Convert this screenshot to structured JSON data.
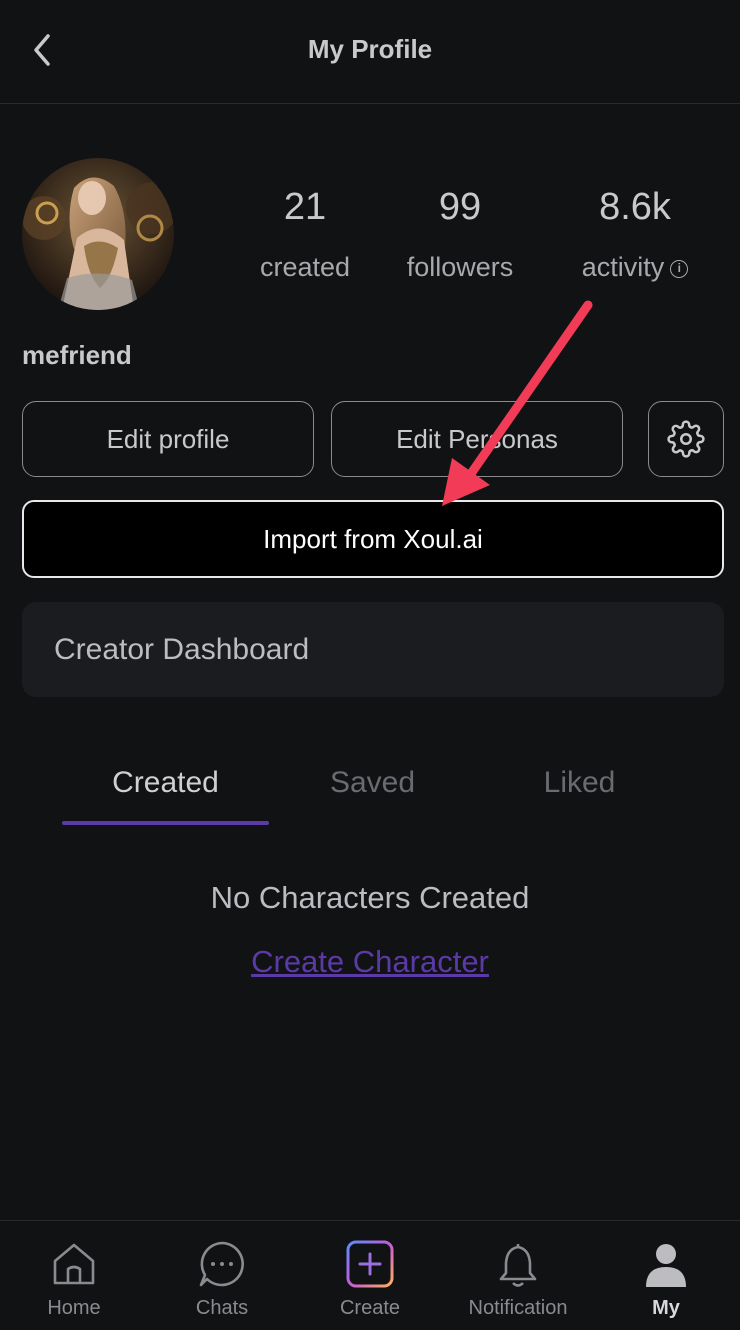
{
  "header": {
    "title": "My Profile",
    "back_icon": "chevron-left-icon"
  },
  "profile": {
    "username": "mefriend",
    "stats": [
      {
        "value": "21",
        "label": "created"
      },
      {
        "value": "99",
        "label": "followers"
      },
      {
        "value": "8.6k",
        "label": "activity"
      }
    ],
    "info_icon_glyph": "i"
  },
  "actions": {
    "edit_profile": "Edit profile",
    "edit_personas": "Edit Personas",
    "settings_icon": "gear-icon",
    "import": "Import from Xoul.ai",
    "creator_dashboard": "Creator Dashboard"
  },
  "tabs": [
    {
      "label": "Created",
      "active": true
    },
    {
      "label": "Saved",
      "active": false
    },
    {
      "label": "Liked",
      "active": false
    }
  ],
  "empty_state": {
    "message": "No Characters Created",
    "link": "Create Character"
  },
  "bottom_nav": [
    {
      "label": "Home",
      "icon": "home-icon"
    },
    {
      "label": "Chats",
      "icon": "chat-bubble-icon"
    },
    {
      "label": "Create",
      "icon": "plus-square-icon"
    },
    {
      "label": "Notification",
      "icon": "bell-icon"
    },
    {
      "label": "My",
      "icon": "person-icon",
      "active": true
    }
  ],
  "colors": {
    "background": "#111214",
    "accent_purple": "#5b3aa8",
    "annotation_arrow": "#f23c57"
  }
}
